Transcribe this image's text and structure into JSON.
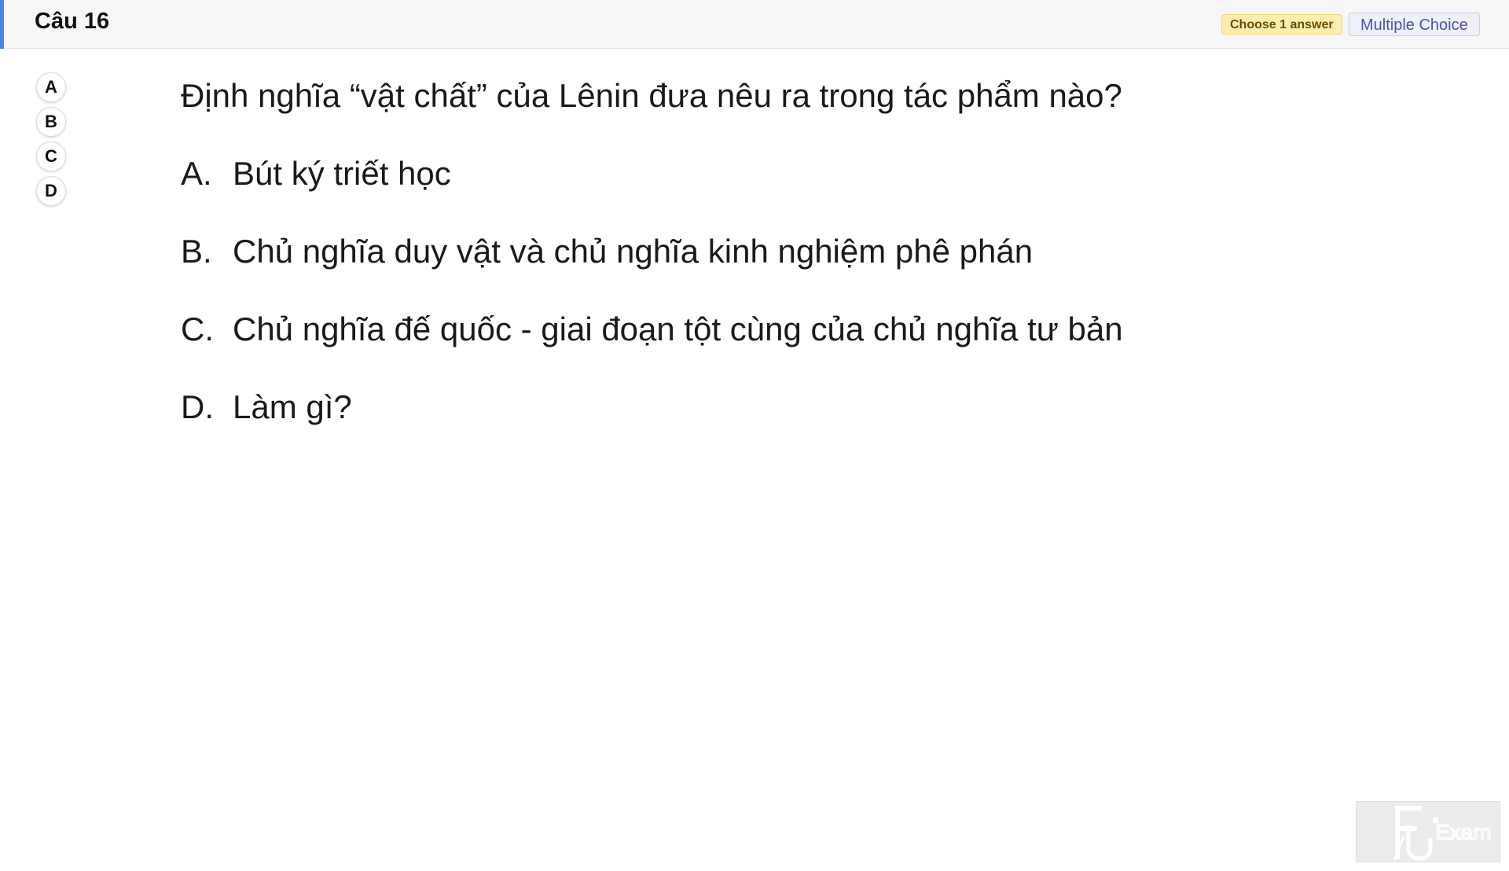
{
  "header": {
    "title": "Câu 16",
    "instruction_badge": "Choose 1 answer",
    "type_badge": "Multiple Choice",
    "accent_color": "#4a86e8"
  },
  "selector_options": [
    "A",
    "B",
    "C",
    "D"
  ],
  "question": {
    "text": "Định nghĩa “vật chất” của Lênin đưa nêu ra trong tác phẩm nào?",
    "answers": [
      {
        "letter": "A.",
        "text": "Bút ký triết học"
      },
      {
        "letter": "B.",
        "text": "Chủ nghĩa duy vật và chủ nghĩa kinh nghiệm phê phán"
      },
      {
        "letter": "C.",
        "text": "Chủ nghĩa đế quốc - giai đoạn tột cùng của chủ nghĩa tư bản"
      },
      {
        "letter": "D.",
        "text": "Làm gì?"
      }
    ]
  },
  "watermark": {
    "logo_text": "FU Exam",
    "icon": "fu-exam-logo"
  }
}
